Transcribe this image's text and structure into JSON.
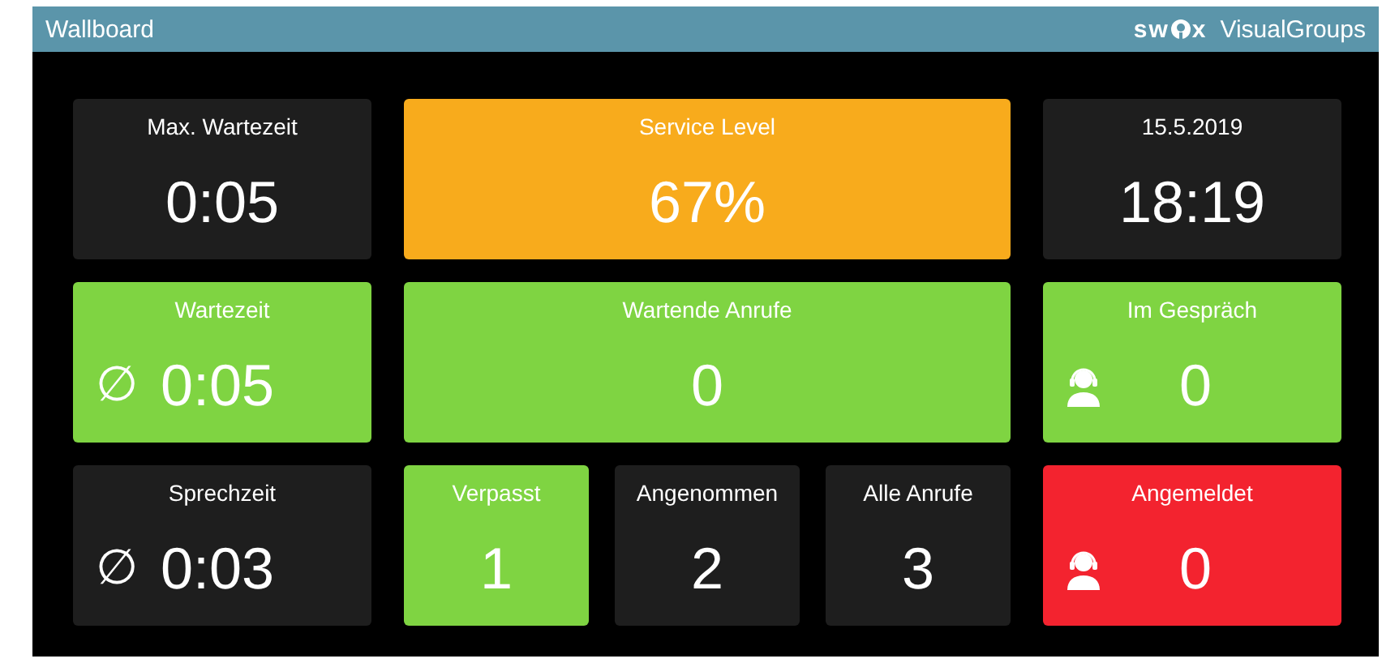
{
  "header": {
    "title": "Wallboard",
    "logo": [
      "sw",
      "x"
    ],
    "brand": "VisualGroups"
  },
  "rows": [
    [
      {
        "kind": "plain",
        "title": "Max. Wartezeit",
        "value": "0:05",
        "color": "#1e1e1e"
      },
      {
        "kind": "plain",
        "title": "Service Level",
        "value": "67%",
        "color": "#f8ab1c"
      },
      {
        "kind": "plain",
        "title": "15.5.2019",
        "value": "18:19",
        "color": "#1e1e1e"
      }
    ],
    [
      {
        "kind": "average",
        "title": "Wartezeit",
        "symbol": "∅",
        "value": "0:05",
        "color": "#7fd442"
      },
      {
        "kind": "plain",
        "title": "Wartende Anrufe",
        "value": "0",
        "color": "#7fd442"
      },
      {
        "kind": "agent",
        "title": "Im Gespräch",
        "value": "0",
        "color": "#7fd442"
      }
    ],
    [
      {
        "kind": "average",
        "title": "Sprechzeit",
        "symbol": "∅",
        "value": "0:03",
        "color": "#1e1e1e"
      },
      {
        "kind": "group",
        "tiles": [
          {
            "kind": "plain",
            "title": "Verpasst",
            "value": "1",
            "color": "#7fd442"
          },
          {
            "kind": "plain",
            "title": "Angenommen",
            "value": "2",
            "color": "#1e1e1e"
          },
          {
            "kind": "plain",
            "title": "Alle Anrufe",
            "value": "3",
            "color": "#1e1e1e"
          }
        ]
      },
      {
        "kind": "agent",
        "title": "Angemeldet",
        "value": "0",
        "color": "#f3232f"
      }
    ]
  ]
}
